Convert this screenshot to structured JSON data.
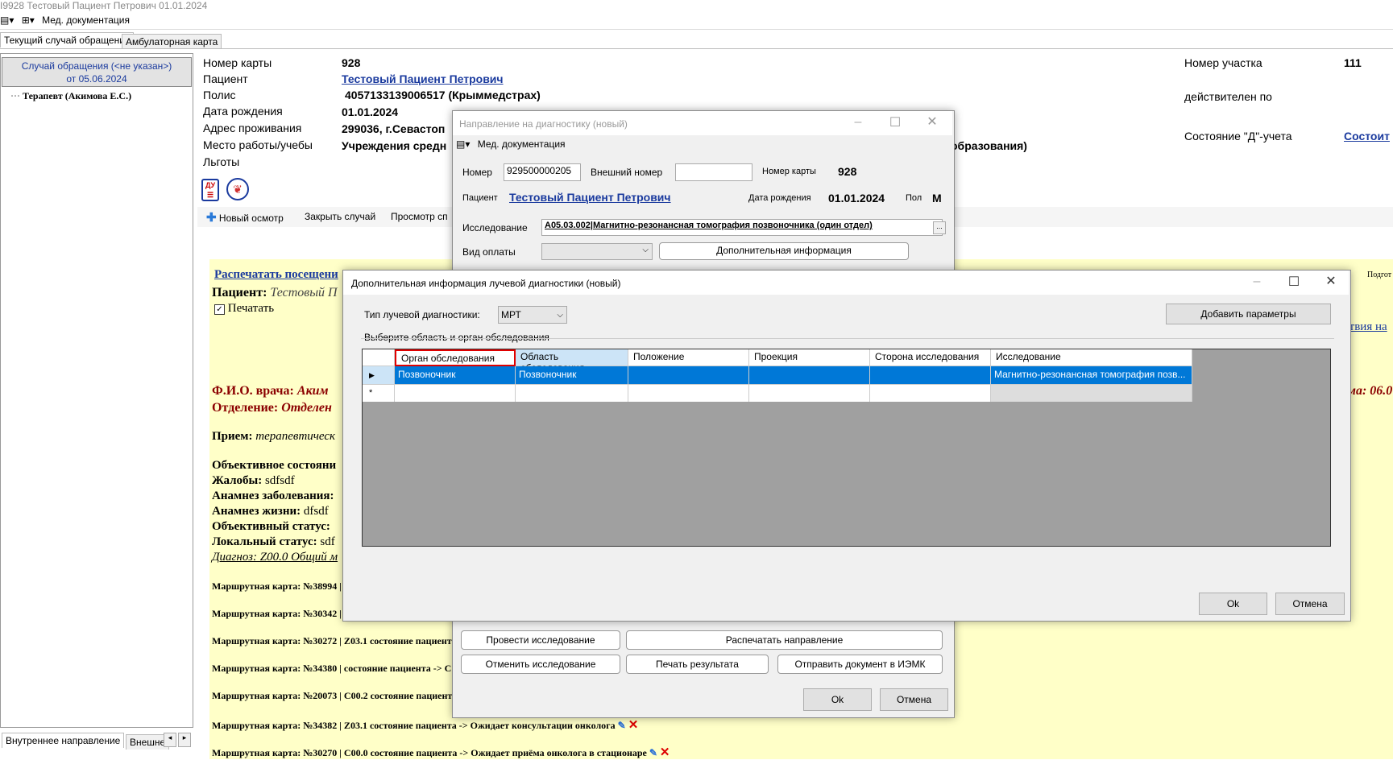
{
  "window": {
    "title": "I9928 Тестовый Пациент Петрович 01.01.2024",
    "menu_label": "Мед. документация"
  },
  "tabs": [
    "Текущий случай обращения",
    "Амбулаторная карта"
  ],
  "left": {
    "case_title": "Случай обращения (<не указан>)",
    "case_date": "от 05.06.2024",
    "tree_item": "Терапевт (Акимова Е.С.)",
    "bottom_tabs": [
      "Внутреннее направление",
      "Внешне"
    ]
  },
  "patient": {
    "card_label": "Номер карты",
    "card_value": "928",
    "patient_label": "Пациент",
    "patient_value": "Тестовый Пациент Петрович",
    "policy_label": "Полис",
    "policy_value": "4057133139006517 (Крыммедстрах)",
    "birth_label": "Дата рождения",
    "birth_value": "01.01.2024",
    "address_label": "Адрес проживания",
    "address_value": "299036, г.Севастоп",
    "work_label": "Место работы/учебы",
    "work_value": "Учреждения средн",
    "work_tail": "образования)",
    "benefits_label": "Льготы",
    "district_label": "Номер участка",
    "district_value": "111",
    "valid_label": "действителен по",
    "d_label": "Состояние \"Д\"-учета",
    "d_value": "Состоит"
  },
  "toolbar": {
    "new_exam": "Новый осмотр",
    "close_case": "Закрыть случай",
    "view": "Просмотр сп"
  },
  "content": {
    "print_visits": "Распечатать посещени",
    "patient_line_label": "Пациент:",
    "patient_line_value": "Тестовый П",
    "print_checkbox": "Печатать",
    "right_podgot": "Подгот",
    "right_link": "ствия на",
    "right_date": "ма: 06.0",
    "doctor_label": "Ф.И.О. врача:",
    "doctor_value": "Аким",
    "dept_label": "Отделение:",
    "dept_value": "Отделен",
    "reception_label": "Прием:",
    "reception_value": "терапевтическ",
    "objective_state": "Объективное состояни",
    "complaints_label": "Жалобы:",
    "complaints_value": "sdfsdf",
    "anamnesis_label": "Анамнез заболевания:",
    "life_label": "Анамнез жизни:",
    "life_value": "dfsdf",
    "obj_status": "Объективный статус:",
    "local_label": "Локальный статус:",
    "local_value": "sdf",
    "diagnosis": "Диагноз: Z00.0 Общий м",
    "routes": [
      "Маршрутная карта: №38994 |",
      "Маршрутная карта: №30342 |",
      "Маршрутная карта: №30272 | Z03.1 состояние пациент",
      "Маршрутная карта: №34380 | состояние пациента -> С",
      "Маршрутная карта: №20073 | C00.2 состояние пациент",
      "Маршрутная карта: №34382 | Z03.1 состояние пациента -> Ожидает консультации онколога",
      "Маршрутная карта: №30270 | C00.0 состояние пациента -> Ожидает приёма онколога в стационаре"
    ]
  },
  "dialog1": {
    "title": "Направление на диагностику (новый)",
    "menu_label": "Мед. документация",
    "number_label": "Номер",
    "number_value": "929500000205",
    "ext_number_label": "Внешний номер",
    "ext_number_value": "",
    "card_label": "Номер карты",
    "card_value": "928",
    "patient_label": "Пациент",
    "patient_value": "Тестовый Пациент Петрович",
    "birth_label": "Дата рождения",
    "birth_value": "01.01.2024",
    "sex_label": "Пол",
    "sex_value": "М",
    "study_label": "Исследование",
    "study_value": "A05.03.002|Магнитно-резонансная томография позвоночника (один отдел)",
    "payment_label": "Вид оплаты",
    "payment_value": "",
    "extra_info_button": "Дополнительная информация",
    "btn_conduct": "Провести исследование",
    "btn_print_dir": "Распечатать направление",
    "btn_cancel_study": "Отменить исследование",
    "btn_print_result": "Печать результата",
    "btn_send": "Отправить документ в ИЭМК",
    "ok": "Ok",
    "cancel": "Отмена"
  },
  "dialog2": {
    "title": "Дополнительная информация лучевой диагностики (новый)",
    "type_label": "Тип лучевой диагностики:",
    "type_value": "МРТ",
    "add_params_button": "Добавить параметры",
    "group_label": "Выберите область и орган обследования",
    "columns": [
      "Орган обследования",
      "Область обследования",
      "Положение",
      "Проекция",
      "Сторона исследования",
      "Исследование"
    ],
    "rows": [
      [
        "Позвоночник",
        "Позвоночник",
        "",
        "",
        "",
        "Магнитно-резонансная томография позв..."
      ]
    ],
    "ok": "Ok",
    "cancel": "Отмена"
  },
  "colors": {
    "link": "#1a3a9e",
    "selection": "#0078d7",
    "content_bg": "#ffffc8",
    "doc_red": "#8b0000",
    "highlight_border": "#e00000"
  }
}
